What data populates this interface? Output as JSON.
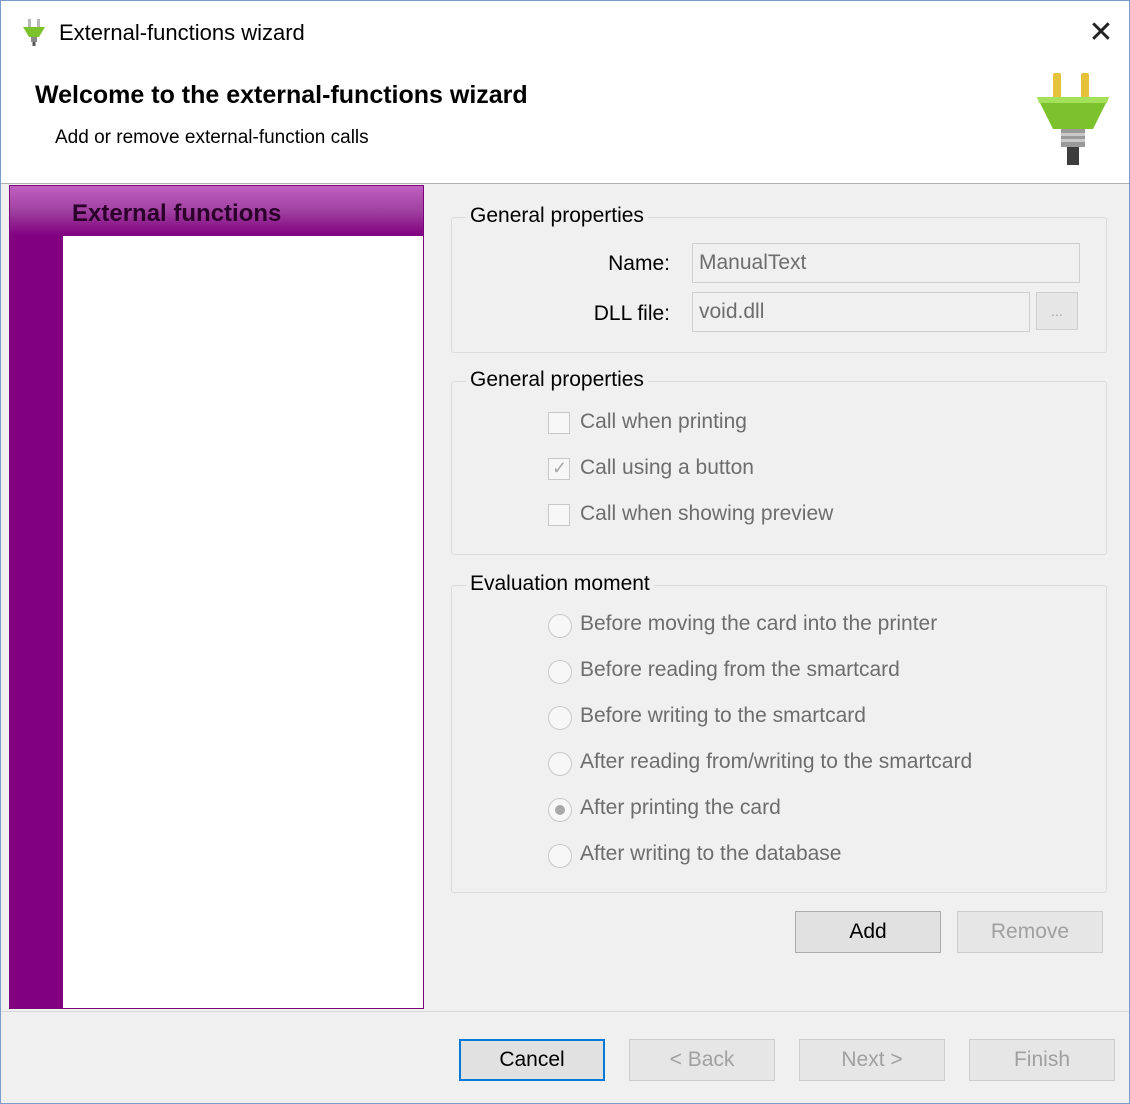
{
  "window": {
    "title": "External-functions wizard",
    "close_label": "✕"
  },
  "header": {
    "title": "Welcome to the external-functions wizard",
    "subtitle": "Add or remove external-function calls"
  },
  "list": {
    "header": "External functions",
    "items": []
  },
  "general_properties": {
    "title": "General properties",
    "name_label": "Name:",
    "name_value": "ManualText",
    "dll_label": "DLL file:",
    "dll_value": "void.dll",
    "browse_label": "..."
  },
  "call_options": {
    "title": "General properties",
    "items": [
      {
        "label": "Call when printing",
        "checked": false
      },
      {
        "label": "Call using a button",
        "checked": true
      },
      {
        "label": "Call when showing preview",
        "checked": false
      }
    ]
  },
  "evaluation": {
    "title": "Evaluation moment",
    "items": [
      {
        "label": "Before moving the card into the printer",
        "selected": false
      },
      {
        "label": "Before reading from the smartcard",
        "selected": false
      },
      {
        "label": "Before writing to the smartcard",
        "selected": false
      },
      {
        "label": "After reading from/writing to the smartcard",
        "selected": false
      },
      {
        "label": "After printing the card",
        "selected": true
      },
      {
        "label": "After writing to the database",
        "selected": false
      }
    ]
  },
  "actions": {
    "add_label": "Add",
    "remove_label": "Remove"
  },
  "footer": {
    "cancel_label": "Cancel",
    "back_label": "< Back",
    "next_label": "Next >",
    "finish_label": "Finish"
  },
  "colors": {
    "accent": "#800080",
    "focus_border": "#0a78d7",
    "icon_green": "#7cc22c"
  },
  "icons": {
    "app": "plug-icon",
    "header": "plug-icon",
    "close": "close-icon"
  }
}
